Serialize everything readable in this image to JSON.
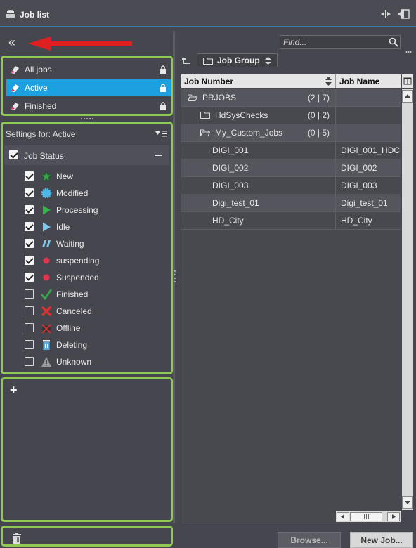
{
  "window": {
    "title": "Job list"
  },
  "sidebar": {
    "collapse_label": "«",
    "views": [
      {
        "label": "All jobs",
        "selected": false
      },
      {
        "label": "Active",
        "selected": true
      },
      {
        "label": "Finished",
        "selected": false
      }
    ],
    "settings_label": "Settings for: Active",
    "job_status": {
      "label": "Job Status",
      "checked": true
    },
    "statuses": [
      {
        "label": "New",
        "checked": true,
        "icon": "star-icon",
        "color": "#3aa84a"
      },
      {
        "label": "Modified",
        "checked": true,
        "icon": "gear-dot-icon",
        "color": "#4fb6e6"
      },
      {
        "label": "Processing",
        "checked": true,
        "icon": "play-icon",
        "color": "#35b54a"
      },
      {
        "label": "Idle",
        "checked": true,
        "icon": "play-outline-icon",
        "color": "#7fc9ee"
      },
      {
        "label": "Waiting",
        "checked": true,
        "icon": "pause-slash-icon",
        "color": "#7fc9ee"
      },
      {
        "label": "suspending",
        "checked": true,
        "icon": "red-dot-icon",
        "color": "#e0364e"
      },
      {
        "label": "Suspended",
        "checked": true,
        "icon": "red-dot-icon",
        "color": "#e0364e"
      },
      {
        "label": "Finished",
        "checked": false,
        "icon": "checkmark-icon",
        "color": "#3aa84a"
      },
      {
        "label": "Canceled",
        "checked": false,
        "icon": "x-icon",
        "color": "#e03030"
      },
      {
        "label": "Offline",
        "checked": false,
        "icon": "offline-icon",
        "color": "#cc3030"
      },
      {
        "label": "Deleting",
        "checked": false,
        "icon": "trash-icon",
        "color": "#5aaee0"
      },
      {
        "label": "Unknown",
        "checked": false,
        "icon": "warning-icon",
        "color": "#9a9a9a"
      }
    ],
    "add_label": "+"
  },
  "search": {
    "placeholder": "Find..."
  },
  "grouping": {
    "label": "Job Group"
  },
  "table": {
    "columns": [
      "Job Number",
      "Job Name"
    ],
    "rows": [
      {
        "number": "PRJOBS",
        "count": "(2 | 7)",
        "name": "",
        "type": "group"
      },
      {
        "number": "HdSysChecks",
        "count": "(0 | 2)",
        "name": "",
        "type": "subgroup"
      },
      {
        "number": "My_Custom_Jobs",
        "count": "(0 | 5)",
        "name": "",
        "type": "subgroup-open"
      },
      {
        "number": "DIGI_001",
        "count": "",
        "name": "DIGI_001_HDC",
        "type": "job"
      },
      {
        "number": "DIGI_002",
        "count": "",
        "name": "DIGI_002",
        "type": "job"
      },
      {
        "number": "DIGI_003",
        "count": "",
        "name": "DIGI_003",
        "type": "job"
      },
      {
        "number": "Digi_test_01",
        "count": "",
        "name": "Digi_test_01",
        "type": "job"
      },
      {
        "number": "HD_City",
        "count": "",
        "name": "HD_City",
        "type": "job"
      }
    ]
  },
  "footer": {
    "browse_label": "Browse...",
    "newjob_label": "New Job..."
  },
  "colors": {
    "accent": "#1ca0e0",
    "highlight_frame": "#8fca55",
    "annotation_arrow": "#e02020"
  }
}
